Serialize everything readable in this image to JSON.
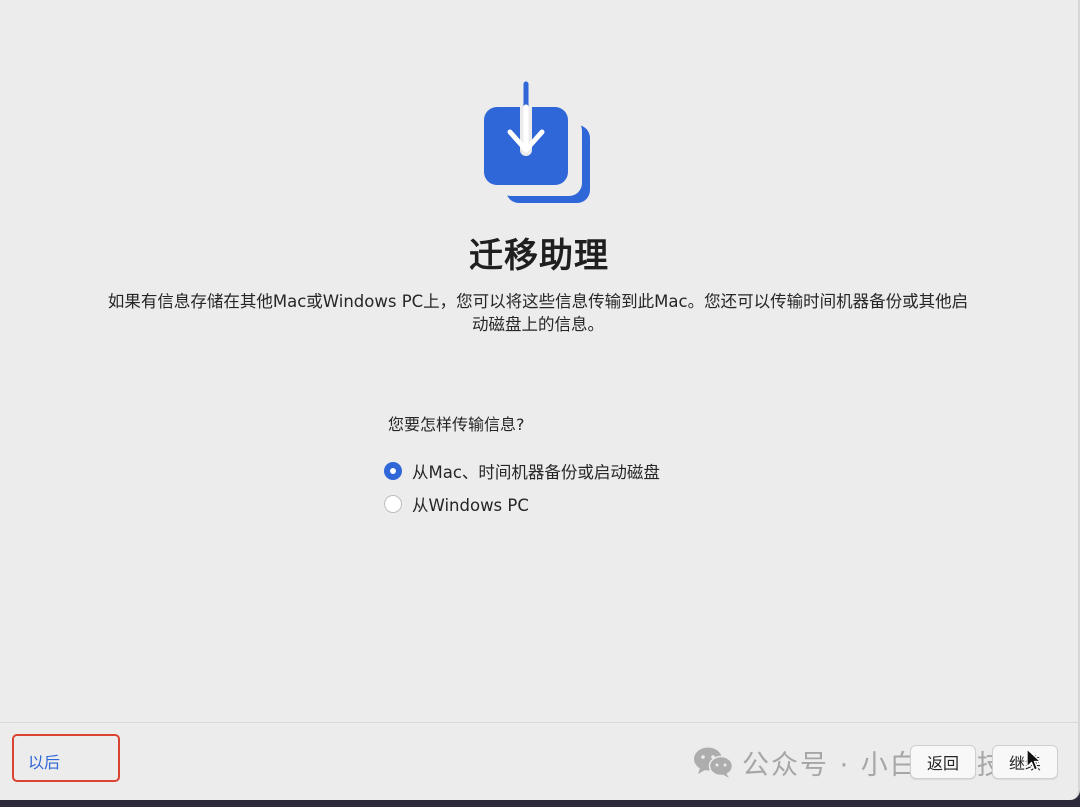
{
  "header": {
    "icon": "migration-download-icon",
    "title": "迁移助理",
    "description": "如果有信息存储在其他Mac或Windows PC上，您可以将这些信息传输到此Mac。您还可以传输时间机器备份或其他启动磁盘上的信息。"
  },
  "transfer": {
    "question": "您要怎样传输信息?",
    "options": [
      {
        "label": "从Mac、时间机器备份或启动磁盘",
        "selected": true
      },
      {
        "label": "从Windows PC",
        "selected": false
      }
    ]
  },
  "footer": {
    "later_label": "以后",
    "back_label": "返回",
    "continue_label": "继续",
    "watermark": "公众号 · 小白电脑技术"
  },
  "colors": {
    "accent": "#2f66d8",
    "highlight": "#d9432f",
    "background": "#ececec"
  }
}
